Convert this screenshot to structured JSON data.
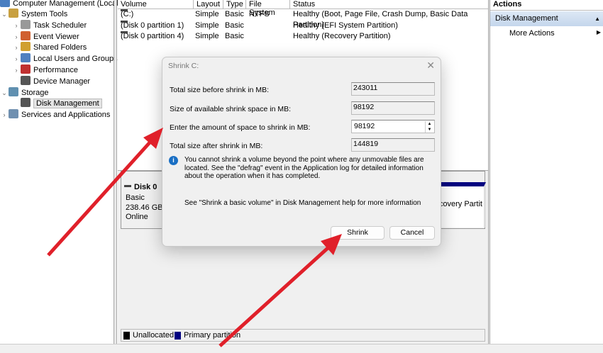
{
  "tree": {
    "root": "Computer Management (Local",
    "items": [
      {
        "label": "System Tools",
        "chevron": "v",
        "icon": "tools-icon",
        "indent": 0
      },
      {
        "label": "Task Scheduler",
        "chevron": ">",
        "icon": "clock-icon",
        "indent": 1
      },
      {
        "label": "Event Viewer",
        "chevron": ">",
        "icon": "event-viewer-icon",
        "indent": 1
      },
      {
        "label": "Shared Folders",
        "chevron": ">",
        "icon": "shared-folders-icon",
        "indent": 1
      },
      {
        "label": "Local Users and Groups",
        "chevron": ">",
        "icon": "users-icon",
        "indent": 1
      },
      {
        "label": "Performance",
        "chevron": ">",
        "icon": "performance-icon",
        "indent": 1
      },
      {
        "label": "Device Manager",
        "chevron": "",
        "icon": "device-manager-icon",
        "indent": 1
      },
      {
        "label": "Storage",
        "chevron": "v",
        "icon": "storage-icon",
        "indent": 0
      },
      {
        "label": "Disk Management",
        "chevron": "",
        "icon": "disk-icon",
        "indent": 1,
        "selected": true
      },
      {
        "label": "Services and Applications",
        "chevron": ">",
        "icon": "services-icon",
        "indent": 0
      }
    ]
  },
  "table": {
    "headers": [
      "Volume",
      "Layout",
      "Type",
      "File System",
      "Status"
    ],
    "rows": [
      [
        "(C:)",
        "Simple",
        "Basic",
        "NTFS",
        "Healthy (Boot, Page File, Crash Dump, Basic Data Partition)"
      ],
      [
        "(Disk 0 partition 1)",
        "Simple",
        "Basic",
        "",
        "Healthy (EFI System Partition)"
      ],
      [
        "(Disk 0 partition 4)",
        "Simple",
        "Basic",
        "",
        "Healthy (Recovery Partition)"
      ]
    ]
  },
  "disk": {
    "name": "Disk 0",
    "type": "Basic",
    "size": "238.46 GB",
    "state": "Online",
    "partition_fragment": "covery Partit"
  },
  "legend": [
    {
      "label": "Unallocated",
      "color": "#000000"
    },
    {
      "label": "Primary partition",
      "color": "#000080"
    }
  ],
  "actions": {
    "title": "Actions",
    "section": "Disk Management",
    "item": "More Actions"
  },
  "dialog": {
    "title": "Shrink C:",
    "fields": [
      {
        "label": "Total size before shrink in MB:",
        "value": "243011"
      },
      {
        "label": "Size of available shrink space in MB:",
        "value": "98192"
      },
      {
        "label": "Enter the amount of space to shrink in MB:",
        "value": "98192"
      },
      {
        "label": "Total size after shrink in MB:",
        "value": "144819"
      }
    ],
    "info": "You cannot shrink a volume beyond the point where any unmovable files are located. See the \"defrag\" event in the Application log for detailed information about the operation when it has completed.",
    "help": "See \"Shrink a basic volume\" in Disk Management help for more information",
    "shrink": "Shrink",
    "cancel": "Cancel"
  },
  "colors": {
    "accent": "#000080",
    "arrow": "#e0202a",
    "info": "#1a6fc4"
  }
}
